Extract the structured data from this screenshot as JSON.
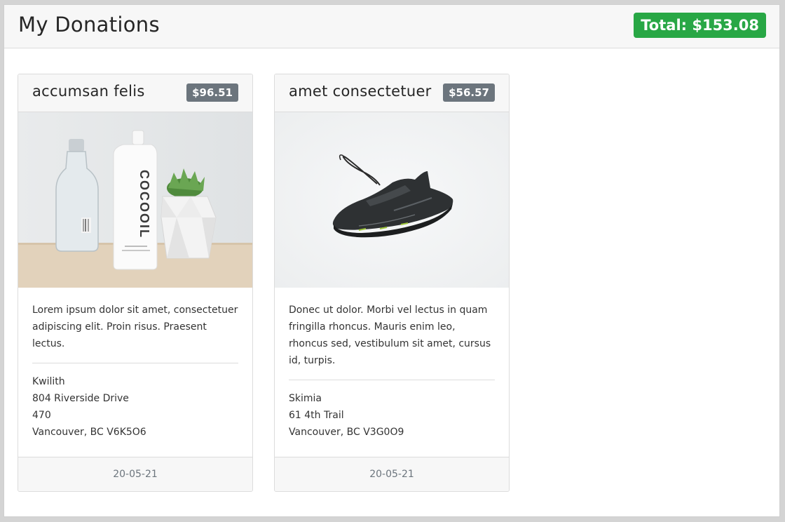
{
  "page": {
    "title": "My Donations",
    "total_label": "Total: $153.08"
  },
  "donations": [
    {
      "name": "accumsan felis",
      "price": "$96.51",
      "image_icon": "cosmetics-product-photo",
      "description": "Lorem ipsum dolor sit amet, consectetuer adipiscing elit. Proin risus. Praesent lectus.",
      "address": [
        "Kwilith",
        "804 Riverside Drive",
        "470",
        "Vancouver, BC V6K5O6"
      ],
      "date": "20-05-21"
    },
    {
      "name": "amet consectetuer",
      "price": "$56.57",
      "image_icon": "sneaker-product-photo",
      "description": "Donec ut dolor. Morbi vel lectus in quam fringilla rhoncus. Mauris enim leo, rhoncus sed, vestibulum sit amet, cursus id, turpis.",
      "address": [
        "Skimia",
        "61 4th Trail",
        "Vancouver, BC V3G0O9"
      ],
      "date": "20-05-21"
    }
  ],
  "colors": {
    "total_badge": "#28a745",
    "price_badge": "#6c757d",
    "header_bg": "#f7f7f7"
  }
}
